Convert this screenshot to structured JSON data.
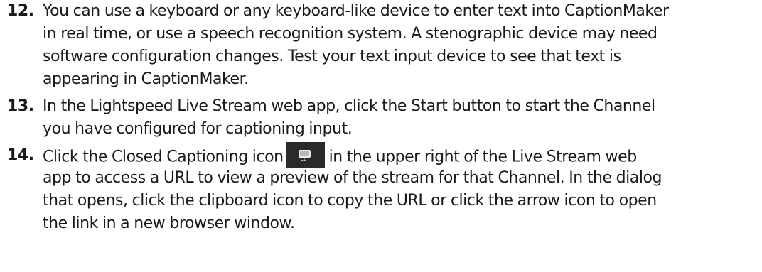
{
  "steps": [
    {
      "number": "12.",
      "lines": [
        "You can use a keyboard or any keyboard-like device to enter text into CaptionMaker",
        "in real time, or use a speech recognition system. A stenographic device may need",
        "software configuration changes. Test your text input device to see that text is",
        "appearing in CaptionMaker."
      ]
    },
    {
      "number": "13.",
      "lines": [
        "In the Lightspeed Live Stream web app, click the Start button to start the Channel",
        "you have configured for captioning input."
      ]
    },
    {
      "number": "14.",
      "first_line_before_icon": "Click the Closed Captioning icon",
      "first_line_after_icon": "in the upper right of the Live Stream web",
      "icon": "closed-captioning-icon",
      "lines": [
        "app to access a URL to view a preview of the stream for that Channel. In the dialog",
        "that opens, click the clipboard icon to copy the URL or click the arrow icon to open",
        "the link in a new browser window."
      ]
    }
  ]
}
